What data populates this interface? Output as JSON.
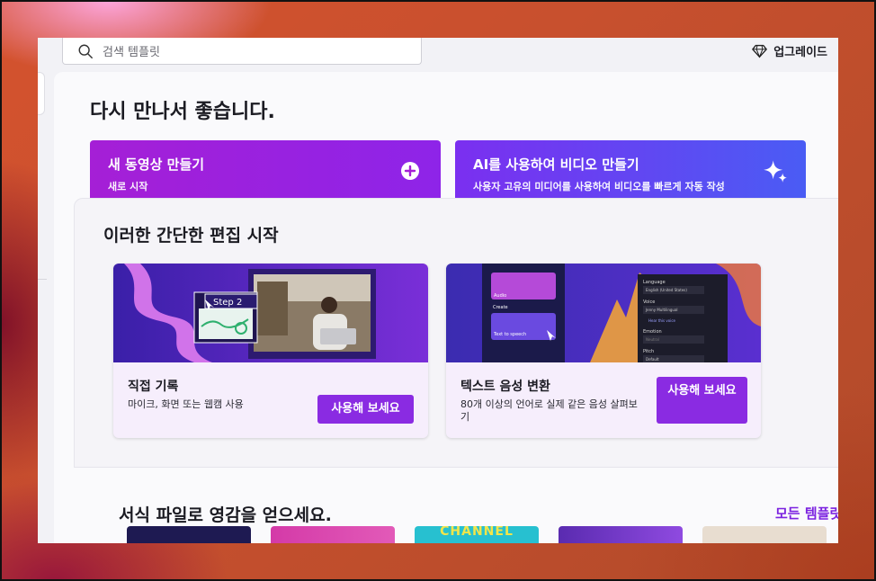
{
  "search": {
    "placeholder": "검색 템플릿"
  },
  "header": {
    "upgrade_label": "업그레이드"
  },
  "main": {
    "greeting": "다시 만나서 좋습니다.",
    "cta_new": {
      "title": "새 동영상 만들기",
      "subtitle": "새로 시작"
    },
    "cta_ai": {
      "title": "AI를 사용하여 비디오 만들기",
      "subtitle": "사용자 고유의 미디어를 사용하여 비디오를 빠르게 자동 작성"
    }
  },
  "quickstart": {
    "title": "이러한 간단한 편집 시작",
    "cards": [
      {
        "title": "직접 기록",
        "description": "마이크, 화면 또는 웹캠 사용",
        "button": "사용해 보세요",
        "thumb_badge": "Step 2"
      },
      {
        "title": "텍스트 음성 변환",
        "description": "80개 이상의 언어로 실제 같은 음성 살펴보기",
        "button": "사용해 보세요",
        "thumb_labels": [
          "Audio",
          "Create",
          "Text to speech",
          "Language",
          "English (United States)",
          "Voice",
          "Jenny Multilingual",
          "Hear this voice",
          "Emotion",
          "Neutral",
          "Pitch",
          "Default"
        ]
      }
    ]
  },
  "templates": {
    "title": "서식 파일로 영감을 얻으세요.",
    "see_all": "모든 템플릿",
    "thumb_text": "CHANNEL"
  },
  "colors": {
    "accent": "#8a2be2",
    "cta_new": "#a51fd6",
    "cta_ai": "#4a5cf4"
  }
}
